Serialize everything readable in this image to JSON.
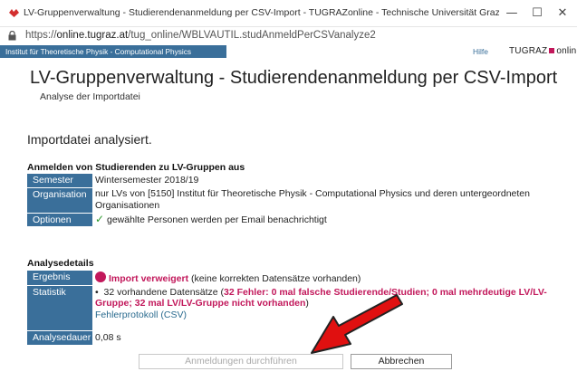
{
  "browser": {
    "window_title": "LV-Gruppenverwaltung - Studierendenanmeldung per CSV-Import - TUGRAZonline - Technische Universität Graz - Google Chrome",
    "url_prefix": "https://",
    "url_host": "online.tugraz.at",
    "url_path": "/tug_online/WBLVAUTIL.studAnmeldPerCSVanalyze2",
    "minimize_glyph": "—",
    "maximize_glyph": "☐",
    "close_glyph": "✕"
  },
  "header": {
    "institute": "Institut für Theoretische Physik - Computational Physics",
    "help": "Hilfe",
    "brand_left": "TUGRAZ",
    "brand_right": "online"
  },
  "page": {
    "title": "LV-Gruppenverwaltung - Studierendenanmeldung per CSV-Import",
    "subtitle": "Analyse der Importdatei",
    "status": "Importdatei analysiert."
  },
  "registration": {
    "heading": "Anmelden von Studierenden zu LV-Gruppen aus",
    "rows": [
      {
        "label": "Semester",
        "value": "Wintersemester 2018/19"
      },
      {
        "label": "Organisation",
        "value": "nur LVs von [5150] Institut für Theoretische Physik - Computational Physics und deren untergeordneten Organisationen"
      },
      {
        "label": "Optionen",
        "value": "gewählte Personen werden per Email benachrichtigt"
      }
    ],
    "check_glyph": "✓"
  },
  "analysis": {
    "heading": "Analysedetails",
    "result_label": "Ergebnis",
    "result_status": "Import verweigert",
    "result_note": "(keine korrekten Datensätze vorhanden)",
    "stats_label": "Statistik",
    "stats_bullet": "•",
    "stats_count": "32 vorhandene Datensätze (",
    "stats_errors": "32 Fehler: 0 mal falsche Studierende/Studien; 0 mal mehrdeutige LV/LV-Gruppe; 32 mal LV/LV-Gruppe nicht vorhanden",
    "stats_close": ")",
    "error_log": "Fehlerprotokoll (CSV)",
    "duration_label": "Analysedauer",
    "duration_value": "0,08 s"
  },
  "actions": {
    "execute": "Anmeldungen durchführen",
    "cancel": "Abbrechen"
  },
  "colors": {
    "header_blue": "#3a6f9a",
    "accent_red": "#c2185b",
    "arrow_red": "#e01010"
  }
}
